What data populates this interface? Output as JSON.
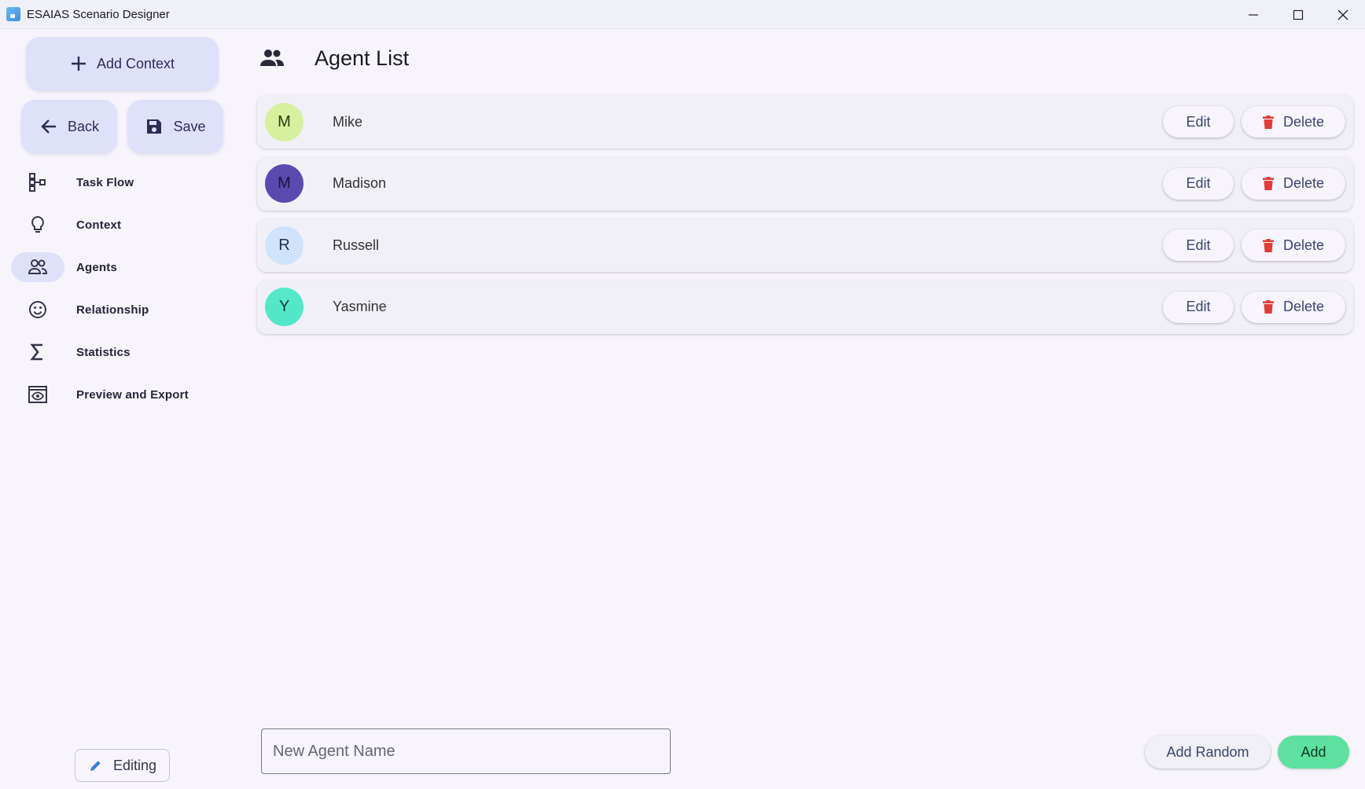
{
  "window": {
    "title": "ESAIAS Scenario Designer",
    "controls": [
      "minimize-icon",
      "maximize-icon",
      "close-icon"
    ]
  },
  "sidebar": {
    "add_context_label": "Add Context",
    "back_label": "Back",
    "save_label": "Save",
    "items": [
      {
        "label": "Task Flow",
        "icon": "task-flow-icon",
        "active": false
      },
      {
        "label": "Context",
        "icon": "lightbulb-icon",
        "active": false
      },
      {
        "label": "Agents",
        "icon": "people-icon",
        "active": true
      },
      {
        "label": "Relationship",
        "icon": "smiley-icon",
        "active": false
      },
      {
        "label": "Statistics",
        "icon": "sigma-icon",
        "active": false
      },
      {
        "label": "Preview and Export",
        "icon": "preview-icon",
        "active": false
      }
    ],
    "editing_label": "Editing"
  },
  "main": {
    "title": "Agent List",
    "agents": [
      {
        "initial": "M",
        "name": "Mike",
        "avatar_bg": "#d6f0a0",
        "avatar_fg": "#2a3a10"
      },
      {
        "initial": "M",
        "name": "Madison",
        "avatar_bg": "#5a4ab0",
        "avatar_fg": "#1a1640"
      },
      {
        "initial": "R",
        "name": "Russell",
        "avatar_bg": "#cfe3fb",
        "avatar_fg": "#1d3050"
      },
      {
        "initial": "Y",
        "name": "Yasmine",
        "avatar_bg": "#52e8c8",
        "avatar_fg": "#0e3a30"
      }
    ],
    "edit_label": "Edit",
    "delete_label": "Delete",
    "new_agent_placeholder": "New Agent Name",
    "new_agent_value": "",
    "add_random_label": "Add Random",
    "add_label": "Add"
  },
  "colors": {
    "accent": "#dfe1fb",
    "add_button": "#5de0a0",
    "delete_icon": "#e53935"
  }
}
